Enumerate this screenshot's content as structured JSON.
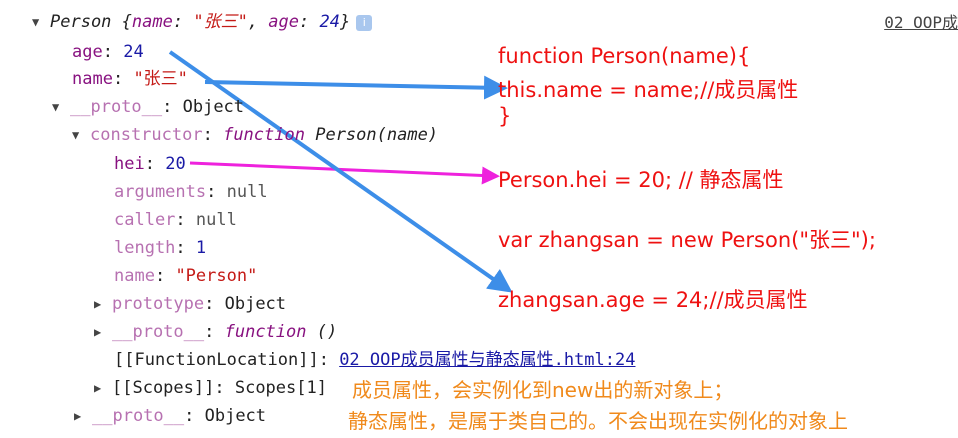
{
  "source_link": "02 OOP成",
  "tree": {
    "root": {
      "prefix": "Person {",
      "k1": "name",
      "v1": "\"张三\"",
      "k2": "age",
      "v2": "24",
      "suffix": "}",
      "info": "i"
    },
    "age": {
      "key": "age",
      "value": "24"
    },
    "name": {
      "key": "name",
      "value": "\"张三\""
    },
    "proto1": {
      "key": "__proto__",
      "value": "Object"
    },
    "constructor": {
      "key": "constructor",
      "kw": "function",
      "value": "Person(name)"
    },
    "hei": {
      "key": "hei",
      "value": "20"
    },
    "arguments": {
      "key": "arguments",
      "value": "null"
    },
    "caller": {
      "key": "caller",
      "value": "null"
    },
    "length": {
      "key": "length",
      "value": "1"
    },
    "fname": {
      "key": "name",
      "value": "\"Person\""
    },
    "prototype": {
      "key": "prototype",
      "value": "Object"
    },
    "proto2": {
      "key": "__proto__",
      "kw": "function",
      "value": "()"
    },
    "funcloc": {
      "key": "[[FunctionLocation]]",
      "value": "02 OOP成员属性与静态属性.html:24"
    },
    "scopes": {
      "key": "[[Scopes]]",
      "value": "Scopes[1]"
    },
    "proto3": {
      "key": "__proto__",
      "value": "Object"
    },
    "colon": ":"
  },
  "notes": {
    "code1": "function Person(name){",
    "code2": " this.name = name;//成员属性",
    "code3": "}",
    "code4": "Person.hei = 20; // 静态属性",
    "code5": "var zhangsan = new Person(\"张三\");",
    "code6": "zhangsan.age = 24;//成员属性",
    "orange1": "成员属性，会实例化到new出的新对象上；",
    "orange2": "静态属性，是属于类自己的。不会出现在实例化的对象上"
  },
  "colors": {
    "red_note": "#ee1111",
    "orange_note": "#f08a1c",
    "blue_arrow": "#3d8ee8",
    "magenta_arrow": "#ee22dd"
  }
}
